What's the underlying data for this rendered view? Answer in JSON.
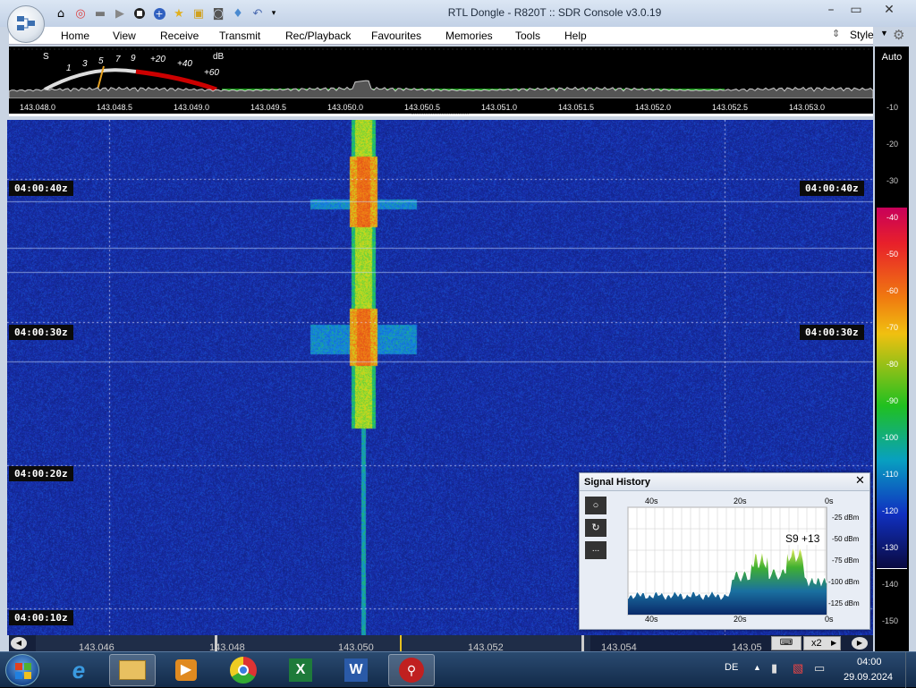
{
  "window": {
    "title": "RTL Dongle - R820T :: SDR Console v3.0.19"
  },
  "quick_access": [
    "home-icon",
    "lifebuoy-icon",
    "folder-icon",
    "play-icon",
    "stop-icon",
    "plus-icon",
    "star-icon",
    "lock-icon",
    "camera-icon",
    "drop-icon",
    "undo-icon",
    "dropdown-icon"
  ],
  "menu": {
    "items": [
      "Home",
      "View",
      "Receive",
      "Transmit",
      "Rec/Playback",
      "Favourites",
      "Memories",
      "Tools",
      "Help"
    ],
    "style": "Style"
  },
  "smeter": {
    "s": "S",
    "db": "dB",
    "scale": [
      "1",
      "3",
      "5",
      "7",
      "9",
      "+20",
      "+40",
      "+60"
    ]
  },
  "frequency_scale": [
    "143.048.0",
    "143.048.5",
    "143.049.0",
    "143.049.5",
    "143.050.0",
    "143.050.5",
    "143.051.0",
    "143.051.5",
    "143.052.0",
    "143.052.5",
    "143.053.0"
  ],
  "right_scale": {
    "auto": "Auto",
    "levels": [
      "-10",
      "-20",
      "-30",
      "-40",
      "-50",
      "-60",
      "-70",
      "-80",
      "-90",
      "-100",
      "-110",
      "-120",
      "-130",
      "-140",
      "-150"
    ]
  },
  "waterfall": {
    "timestamps_left": [
      "04:00:40z",
      "04:00:30z",
      "04:00:20z",
      "04:00:10z"
    ],
    "timestamps_right": [
      "04:00:40z",
      "04:00:30z"
    ]
  },
  "bottom_scale": {
    "labels": [
      "143.046",
      "143.048",
      "143.050",
      "143.052",
      "143.054",
      "143.05"
    ],
    "zoom": "x2"
  },
  "signal_history": {
    "title": "Signal History",
    "top_labels": [
      "40s",
      "20s",
      "0s"
    ],
    "bottom_labels": [
      "40s",
      "20s",
      "0s"
    ],
    "db_labels": [
      "-25 dBm",
      "-50 dBm",
      "-75 dBm",
      "-100 dBm",
      "-125 dBm"
    ],
    "readout": "S9 +13",
    "menu_btn": "..."
  },
  "taskbar": {
    "lang": "DE",
    "time": "04:00",
    "date": "29.09.2024"
  }
}
